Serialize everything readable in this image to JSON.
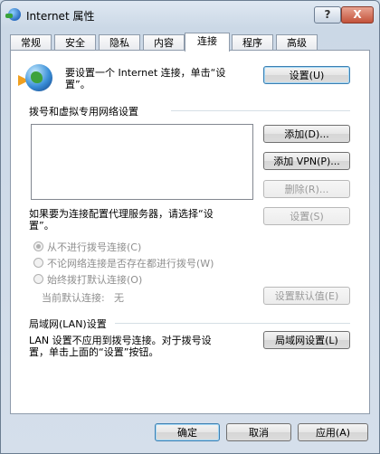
{
  "window": {
    "title": "Internet 属性",
    "help_label": "?",
    "close_label": "X"
  },
  "tabs": [
    {
      "label": "常规"
    },
    {
      "label": "安全"
    },
    {
      "label": "隐私"
    },
    {
      "label": "内容"
    },
    {
      "label": "连接",
      "active": true
    },
    {
      "label": "程序"
    },
    {
      "label": "高级"
    }
  ],
  "setup": {
    "text_line1": "要设置一个 Internet 连接，单击“设",
    "text_line2": "置”。",
    "button": "设置(U)"
  },
  "dialup": {
    "heading": "拨号和虚拟专用网络设置",
    "add_button": "添加(D)...",
    "add_vpn_button": "添加 VPN(P)...",
    "remove_button": "删除(R)...",
    "proxy_text_line1": "如果要为连接配置代理服务器，请选择“设",
    "proxy_text_line2": "置”。",
    "settings_button": "设置(S)",
    "options": [
      {
        "label": "从不进行拨号连接(C)",
        "checked": true
      },
      {
        "label": "不论网络连接是否存在都进行拨号(W)",
        "checked": false
      },
      {
        "label": "始终拨打默认连接(O)",
        "checked": false
      }
    ],
    "current_default_label": "当前默认连接:",
    "current_default_value": "无",
    "set_default_button": "设置默认值(E)"
  },
  "lan": {
    "heading": "局域网(LAN)设置",
    "text_line1": "LAN 设置不应用到拨号连接。对于拨号设",
    "text_line2": "置，单击上面的“设置”按钮。",
    "button": "局域网设置(L)"
  },
  "footer": {
    "ok": "确定",
    "cancel": "取消",
    "apply": "应用(A)"
  }
}
